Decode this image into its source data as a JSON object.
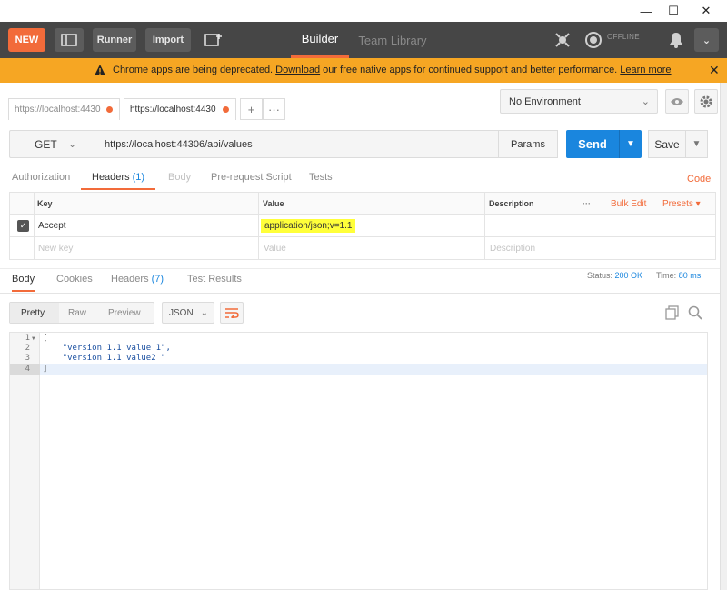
{
  "header": {
    "new_label": "NEW",
    "runner_label": "Runner",
    "import_label": "Import",
    "tabs": [
      {
        "label": "Builder"
      },
      {
        "label": "Team Library"
      }
    ],
    "status": "OFFLINE"
  },
  "banner": {
    "before": "Chrome apps are being deprecated. ",
    "download_link": "Download",
    "middle": " our free native apps for continued support and better performance. ",
    "learn_link": "Learn more"
  },
  "request_tabs": [
    {
      "label": "https://localhost:4430"
    },
    {
      "label": "https://localhost:4430"
    }
  ],
  "environment": {
    "selected": "No Environment"
  },
  "request": {
    "method": "GET",
    "url": "https://localhost:44306/api/values",
    "params_label": "Params",
    "send_label": "Send",
    "save_label": "Save"
  },
  "request_subtabs": {
    "authorization": "Authorization",
    "headers": "Headers",
    "headers_count": "(1)",
    "body": "Body",
    "prerequest": "Pre-request Script",
    "tests": "Tests",
    "code": "Code"
  },
  "headers_table": {
    "col_key": "Key",
    "col_value": "Value",
    "col_description": "Description",
    "bulk_edit": "Bulk Edit",
    "presets": "Presets",
    "rows": [
      {
        "key": "Accept",
        "value": "application/json;v=1.1",
        "description": ""
      }
    ],
    "placeholder_key": "New key",
    "placeholder_value": "Value",
    "placeholder_description": "Description"
  },
  "response_tabs": {
    "body": "Body",
    "cookies": "Cookies",
    "headers": "Headers",
    "headers_count": "(7)",
    "test_results": "Test Results"
  },
  "response_status": {
    "status_label": "Status:",
    "status_value": "200 OK",
    "time_label": "Time:",
    "time_value": "80 ms"
  },
  "response_format": {
    "pretty": "Pretty",
    "raw": "Raw",
    "preview": "Preview",
    "type": "JSON"
  },
  "response_body": {
    "lines": [
      {
        "num": "1",
        "text": "["
      },
      {
        "num": "2",
        "text": "    \"version 1.1 value 1\","
      },
      {
        "num": "3",
        "text": "    \"version 1.1 value2 \""
      },
      {
        "num": "4",
        "text": "]"
      }
    ]
  },
  "colors": {
    "accent": "#f26b3a",
    "send_blue": "#1a86de",
    "banner": "#f6a623",
    "header_bg": "#464646",
    "highlight": "#ffff3a"
  }
}
